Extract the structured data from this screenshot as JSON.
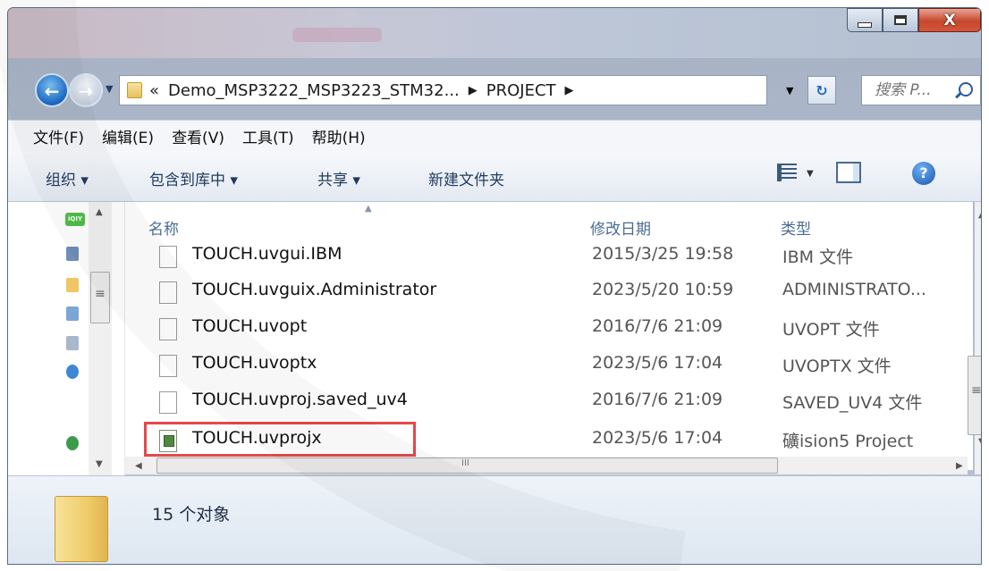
{
  "window": {
    "controls": {
      "minimize": "–",
      "maximize": "□",
      "close": "X"
    }
  },
  "nav": {
    "back_glyph": "←",
    "forward_glyph": "→",
    "breadcrumb": [
      "«",
      "Demo_MSP3222_MSP3223_STM32...",
      "PROJECT"
    ],
    "search_placeholder": "搜索 P..."
  },
  "menu": [
    "文件(F)",
    "编辑(E)",
    "查看(V)",
    "工具(T)",
    "帮助(H)"
  ],
  "toolbar": {
    "organize": "组织 ▾",
    "include_library": "包含到库中 ▾",
    "share": "共享 ▾",
    "new_folder": "新建文件夹"
  },
  "columns": {
    "name": "名称",
    "date": "修改日期",
    "type": "类型"
  },
  "files": [
    {
      "name": "TOUCH.uvgui.IBM",
      "date": "2015/3/25 19:58",
      "type": "IBM 文件",
      "icon": "generic-file-icon"
    },
    {
      "name": "TOUCH.uvguix.Administrator",
      "date": "2023/5/20 10:59",
      "type": "ADMINISTRATO...",
      "icon": "generic-file-icon"
    },
    {
      "name": "TOUCH.uvopt",
      "date": "2016/7/6 21:09",
      "type": "UVOPT 文件",
      "icon": "generic-file-icon"
    },
    {
      "name": "TOUCH.uvoptx",
      "date": "2023/5/6 17:04",
      "type": "UVOPTX 文件",
      "icon": "generic-file-icon"
    },
    {
      "name": "TOUCH.uvproj.saved_uv4",
      "date": "2016/7/6 21:09",
      "type": "SAVED_UV4 文件",
      "icon": "generic-file-icon"
    },
    {
      "name": "TOUCH.uvprojx",
      "date": "2023/5/6 17:04",
      "type": "礦ision5 Project",
      "icon": "uvision-project-icon",
      "highlighted": true
    }
  ],
  "navpane": {
    "iqiyi_label": "iQIY"
  },
  "status": {
    "count": "15 个对象"
  },
  "colors": {
    "highlight_box": "#e5484d",
    "link_blue": "#1e3a5f"
  }
}
